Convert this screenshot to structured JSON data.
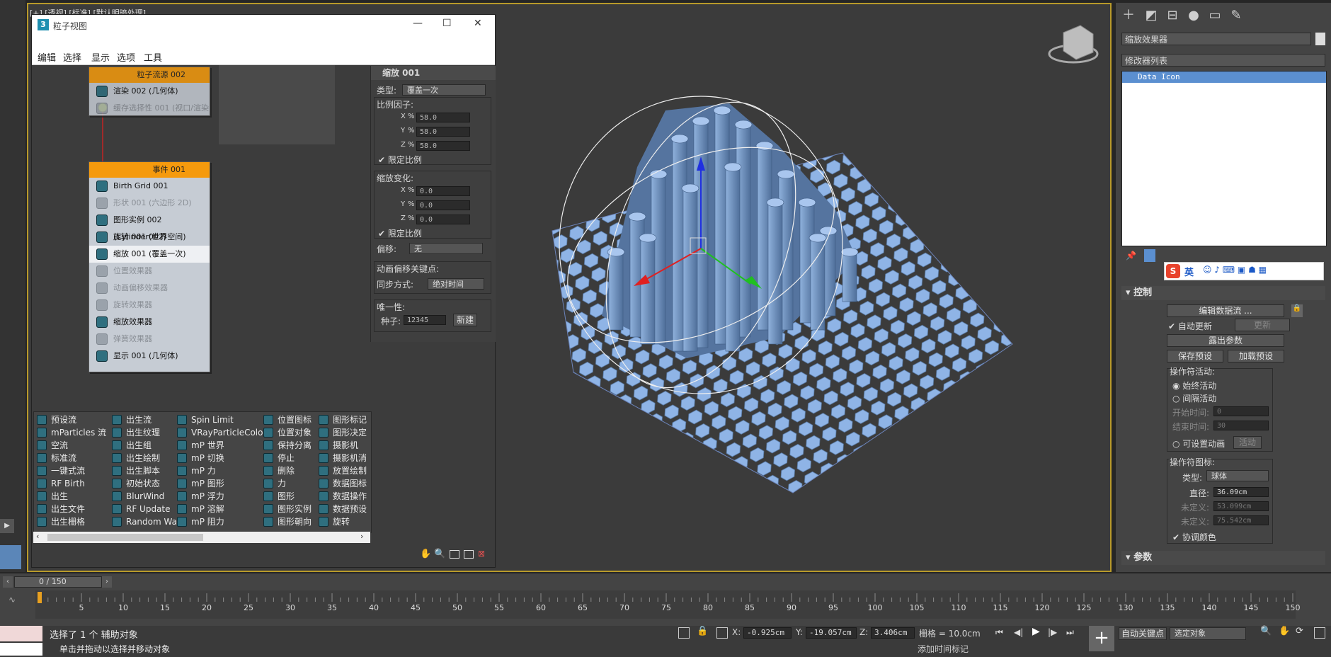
{
  "viewport": {
    "label": "[+] [透视] [标准] [默认明暗处理]"
  },
  "particle_view": {
    "title": "粒子视图",
    "window_controls": {
      "min": "—",
      "max": "☐",
      "close": "✕"
    },
    "menu": [
      "编辑",
      "选择",
      "显示",
      "选项",
      "工具"
    ],
    "flow_node": {
      "title": "粒子流源 002",
      "ops": [
        {
          "label": "渲染 002 (几何体)",
          "dim": false
        },
        {
          "label": "缓存选择性 001 (视口/渲染",
          "dim": true
        }
      ]
    },
    "event_node": {
      "title": "事件 001",
      "ops": [
        {
          "label": "Birth Grid 001",
          "dim": false
        },
        {
          "label": "形状 001 (六边形 2D)",
          "dim": true
        },
        {
          "label": "图形实例 002 (Cylinder002)",
          "dim": false
        },
        {
          "label": "旋转 001 (世界空间)",
          "dim": false
        },
        {
          "label": "缩放 001 (覆盖一次)",
          "dim": false,
          "selected": true
        },
        {
          "label": "位置效果器",
          "dim": true
        },
        {
          "label": "动画偏移效果器",
          "dim": true
        },
        {
          "label": "旋转效果器",
          "dim": true
        },
        {
          "label": "缩放效果器",
          "dim": false
        },
        {
          "label": "弹簧效果器",
          "dim": true
        },
        {
          "label": "显示 001 (几何体)",
          "dim": false
        }
      ]
    },
    "params": {
      "title": "缩放 001",
      "type_label": "类型:",
      "type_value": "覆盖一次",
      "scale_factor_label": "比例因子:",
      "scale": [
        {
          "axis": "X",
          "unit": "%",
          "value": "58.0"
        },
        {
          "axis": "Y",
          "unit": "%",
          "value": "58.0"
        },
        {
          "axis": "Z",
          "unit": "%",
          "value": "58.0"
        }
      ],
      "constrain1": "限定比例",
      "variation_label": "缩放变化:",
      "variation": [
        {
          "axis": "X",
          "unit": "%",
          "value": "0.0"
        },
        {
          "axis": "Y",
          "unit": "%",
          "value": "0.0"
        },
        {
          "axis": "Z",
          "unit": "%",
          "value": "0.0"
        }
      ],
      "constrain2": "限定比例",
      "bias_label": "偏移:",
      "bias_value": "无",
      "anim_offset_label": "动画偏移关键点:",
      "sync_label": "同步方式:",
      "sync_value": "绝对时间",
      "unique_label": "唯一性:",
      "seed_label": "种子:",
      "seed_value": "12345",
      "new_button": "新建"
    },
    "depot": [
      [
        "预设流",
        "mParticles 流",
        "空流",
        "标准流",
        "一键式流",
        "RF Birth",
        "出生",
        "出生文件",
        "出生栅格"
      ],
      [
        "出生流",
        "出生纹理",
        "出生组",
        "出生绘制",
        "出生脚本",
        "初始状态",
        "BlurWind",
        "RF Update",
        "Random Walk"
      ],
      [
        "Spin Limit",
        "VRayParticleColor",
        "mP 世界",
        "mP 切换",
        "mP 力",
        "mP 图形",
        "mP 浮力",
        "mP 溶解",
        "mP 阻力"
      ],
      [
        "位置图标",
        "位置对象",
        "保持分离",
        "停止",
        "删除",
        "力",
        "图形",
        "图形实例",
        "图形朝向"
      ],
      [
        "图形标记",
        "图形决定",
        "摄影机",
        "摄影机消",
        "放置绘制",
        "数据图标",
        "数据操作",
        "数据预设",
        "旋转"
      ]
    ]
  },
  "command_panel": {
    "object_name": "缩放效果器",
    "modifier_list": "修改器列表",
    "stack_item": "Data Icon",
    "ime_label": "英",
    "control_rollout": "控制",
    "edit_flow_button": "编辑数据流 ...",
    "auto_update": "自动更新",
    "update_button": "更新",
    "expose_params": "露出参数",
    "save_preset": "保存预设",
    "load_preset": "加载预设",
    "operator_active_label": "操作符活动:",
    "always_active": "始终活动",
    "interval_active": "间隔活动",
    "start_time_label": "开始时间:",
    "start_time_value": "0",
    "end_time_label": "结束时间:",
    "end_time_value": "30",
    "animatable": "可设置动画",
    "active_button": "活动",
    "icon_group_label": "操作符图标:",
    "type_label": "类型:",
    "type_value": "球体",
    "diameter_label": "直径:",
    "diameter_value": "36.09cm",
    "undefined1_label": "未定义:",
    "undefined1_value": "53.099cm",
    "undefined2_label": "未定义:",
    "undefined2_value": "75.542cm",
    "coord_color": "协调颜色",
    "params_rollout": "参数"
  },
  "timeline": {
    "frame_display": "0 / 150",
    "ticks": [
      "5",
      "10",
      "15",
      "20",
      "25",
      "30",
      "35",
      "40",
      "45",
      "50",
      "55",
      "60",
      "65",
      "70",
      "75",
      "80",
      "85",
      "90",
      "95",
      "100",
      "105",
      "110",
      "115",
      "120",
      "125",
      "130",
      "135",
      "140",
      "145",
      "150"
    ]
  },
  "status": {
    "selection": "选择了 1 个 辅助对象",
    "prompt": "单击并拖动以选择并移动对象",
    "x_label": "X:",
    "x_value": "-0.925cm",
    "y_label": "Y:",
    "y_value": "-19.057cm",
    "z_label": "Z:",
    "z_value": "3.406cm",
    "grid": "栅格 = 10.0cm",
    "add_time_tag": "添加时间标记",
    "auto_key": "自动关键点",
    "selected_object": "选定对象"
  },
  "colors": {
    "accent": "#f59a0d",
    "viewport_border": "#b89a2a",
    "selection_blue": "#4d79b8"
  }
}
